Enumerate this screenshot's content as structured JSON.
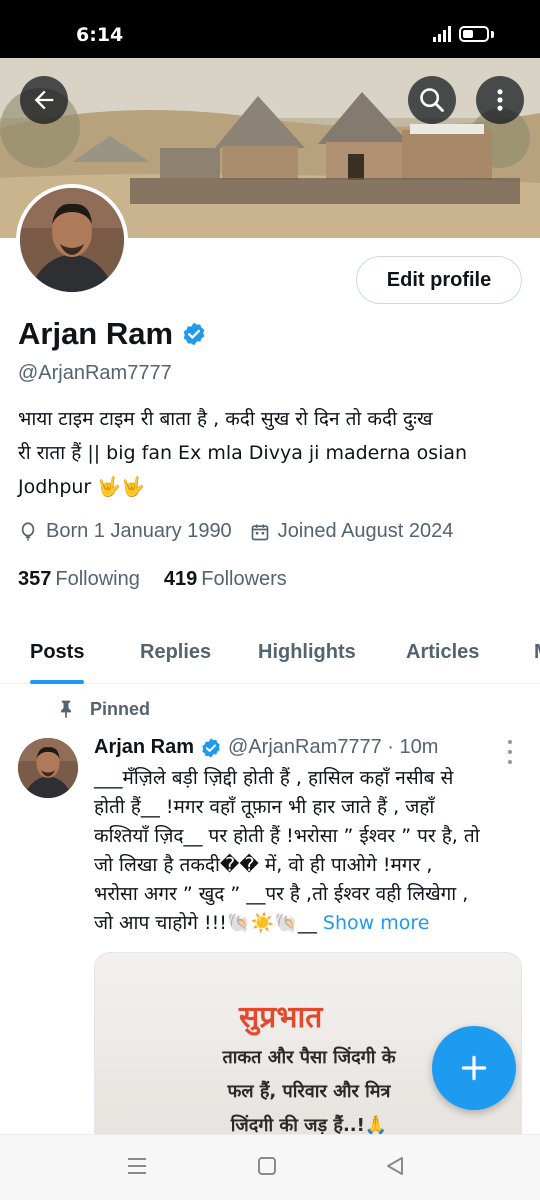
{
  "status_bar": {
    "time": "6:14"
  },
  "profile": {
    "name": "Arjan Ram",
    "handle": "@ArjanRam7777",
    "edit_label": "Edit profile",
    "bio_line1": "भाया टाइम टाइम री  बाता है , कदी सुख रो दिन तो कदी दुःख",
    "bio_line2": "री राता हैं ||  big fan Ex mla Divya ji maderna osian",
    "bio_line3": "Jodhpur 🤟🤟",
    "born": "Born 1 January 1990",
    "joined": "Joined August 2024",
    "following_count": "357",
    "following_label": "Following",
    "followers_count": "419",
    "followers_label": "Followers"
  },
  "tabs": [
    {
      "label": "Posts"
    },
    {
      "label": "Replies"
    },
    {
      "label": "Highlights"
    },
    {
      "label": "Articles"
    },
    {
      "label": "M"
    }
  ],
  "post": {
    "pinned_label": "Pinned",
    "author": "Arjan Ram",
    "handle_time": "@ArjanRam7777 · 10m",
    "text_l1": "___मँज़िले बड़ी ज़िद्दी होती हैं , हासिल कहाँ नसीब से",
    "text_l2": "होती हैं__ !मगर वहाँ तूफ़ान भी हार जाते हैं , जहाँ",
    "text_l3": "कश्तियाँ ज़िद__ पर होती हैं !भरोसा ” ईश्वर ” पर है, तो",
    "text_l4": "जो लिखा है तकदी�� में, वो ही पाओगे !मगर ,",
    "text_l5": "भरोसा अगर ” खुद ” __पर है ,तो ईश्वर वही लिखेगा ,",
    "text_l6": "जो आप चाहोगे !!!🐚☀️🐚__ ",
    "show_more": "Show more",
    "image_title": "सुप्रभात",
    "image_line1": "ताकत और पैसा जिंदगी के",
    "image_line2": "फल हैं, परिवार और मित्र",
    "image_line3": "जिंदगी की जड़ हैं..!🙏"
  },
  "colors": {
    "accent": "#1d9bf0",
    "text": "#0f1419",
    "muted": "#536471"
  }
}
